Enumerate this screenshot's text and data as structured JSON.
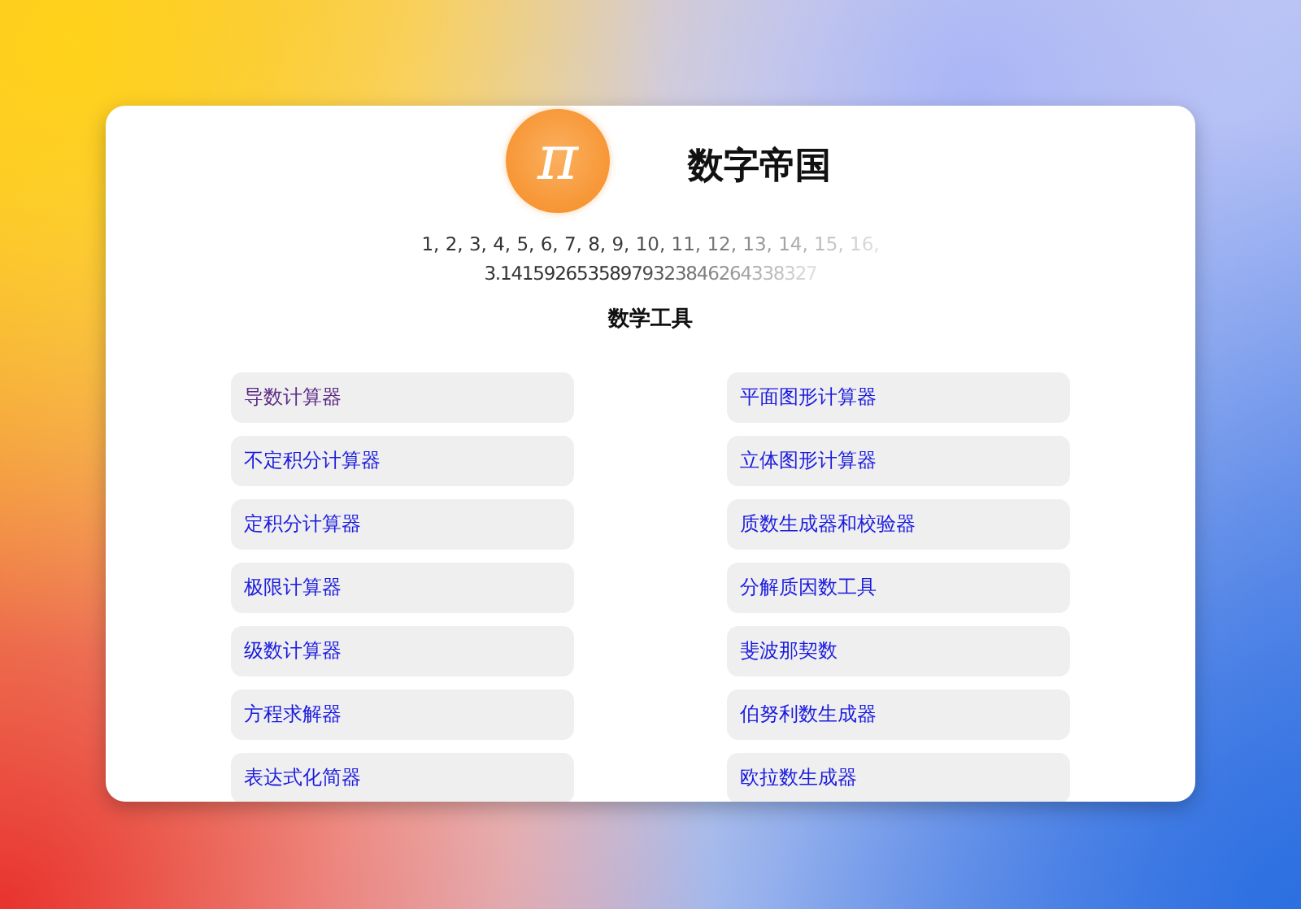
{
  "header": {
    "logo": "π",
    "title": "数字帝国"
  },
  "sequence": "1, 2, 3, 4, 5, 6, 7, 8, 9, 10, 11, 12, 13, 14, 15, 16,",
  "pi_digits": "3.14159265358979323846264338327",
  "section_title": "数学工具",
  "tools": [
    {
      "label": "导数计算器",
      "visited": true
    },
    {
      "label": "平面图形计算器",
      "visited": false
    },
    {
      "label": "不定积分计算器",
      "visited": false
    },
    {
      "label": "立体图形计算器",
      "visited": false
    },
    {
      "label": "定积分计算器",
      "visited": false
    },
    {
      "label": "质数生成器和校验器",
      "visited": false
    },
    {
      "label": "极限计算器",
      "visited": false
    },
    {
      "label": "分解质因数工具",
      "visited": false
    },
    {
      "label": "级数计算器",
      "visited": false
    },
    {
      "label": "斐波那契数",
      "visited": false
    },
    {
      "label": "方程求解器",
      "visited": false
    },
    {
      "label": "伯努利数生成器",
      "visited": false
    },
    {
      "label": "表达式化简器",
      "visited": false
    },
    {
      "label": "欧拉数生成器",
      "visited": false
    }
  ]
}
